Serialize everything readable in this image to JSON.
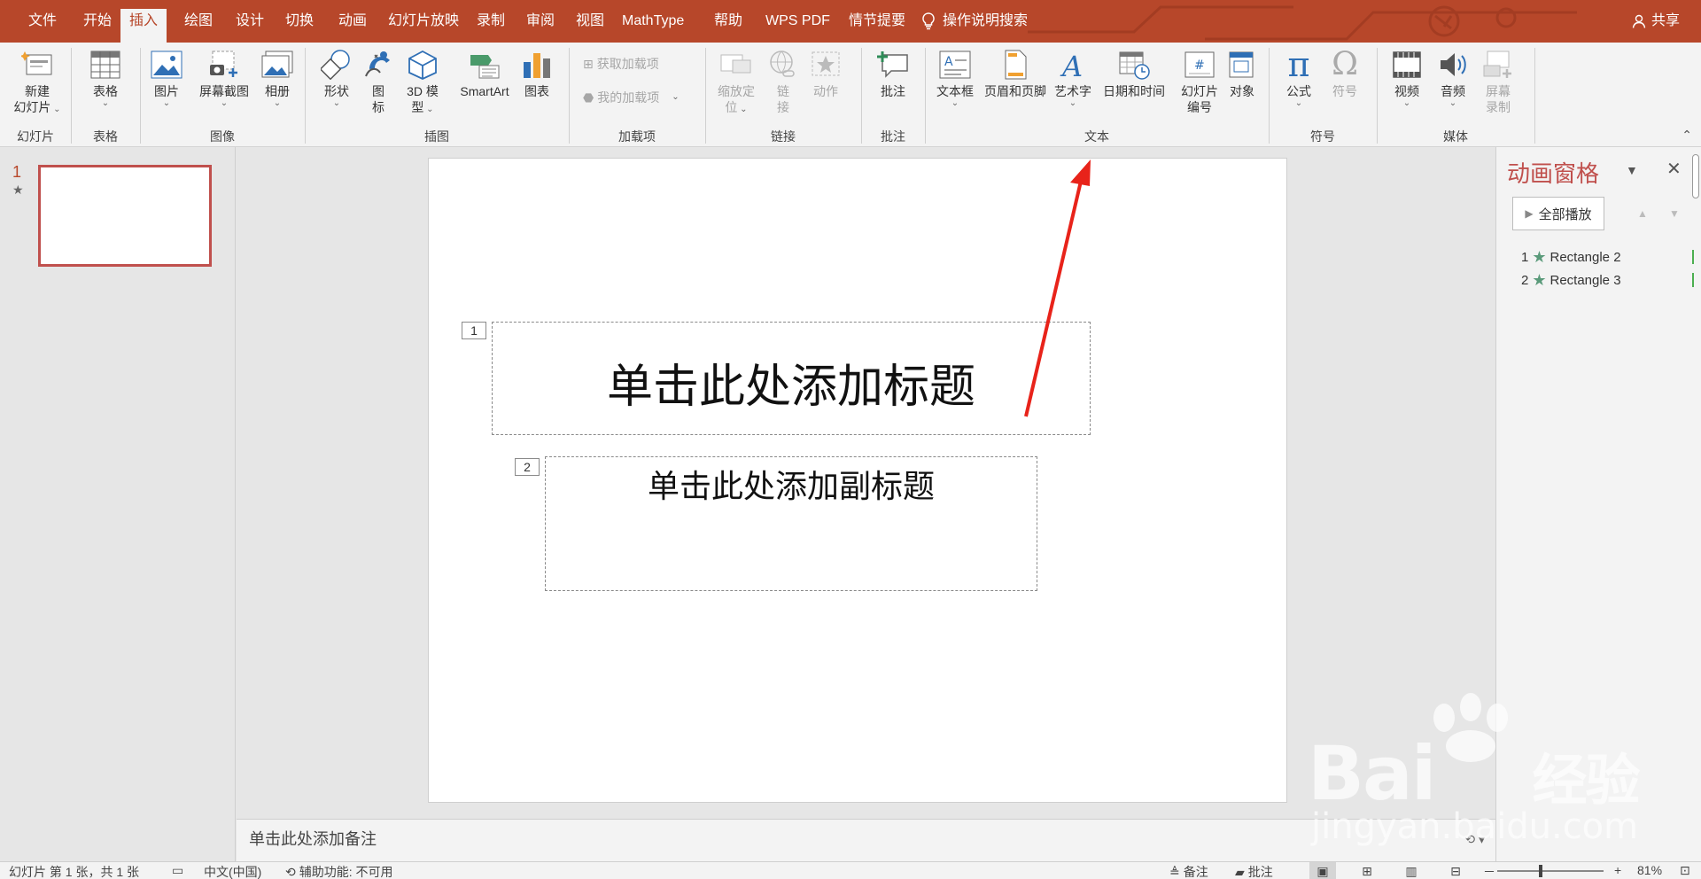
{
  "tabs": [
    {
      "label": "文件",
      "active": false
    },
    {
      "label": "开始",
      "active": false
    },
    {
      "label": "插入",
      "active": true
    },
    {
      "label": "绘图",
      "active": false
    },
    {
      "label": "设计",
      "active": false
    },
    {
      "label": "切换",
      "active": false
    },
    {
      "label": "动画",
      "active": false
    },
    {
      "label": "幻灯片放映",
      "active": false
    },
    {
      "label": "录制",
      "active": false
    },
    {
      "label": "审阅",
      "active": false
    },
    {
      "label": "视图",
      "active": false
    },
    {
      "label": "MathType",
      "active": false
    },
    {
      "label": "帮助",
      "active": false
    },
    {
      "label": "WPS PDF",
      "active": false
    },
    {
      "label": "情节提要",
      "active": false
    }
  ],
  "tell_me": "操作说明搜索",
  "share": "共享",
  "ribbon": {
    "groups": {
      "slides": "幻灯片",
      "tables": "表格",
      "images": "图像",
      "illustrations": "插图",
      "addins": "加载项",
      "links": "链接",
      "comments": "批注",
      "text": "文本",
      "symbols": "符号",
      "media": "媒体"
    },
    "buttons": {
      "new_slide": [
        "新建",
        "幻灯片"
      ],
      "table": "表格",
      "picture": "图片",
      "screenshot": "屏幕截图",
      "album": "相册",
      "shapes": "形状",
      "icons": [
        "图",
        "标"
      ],
      "model3d": [
        "3D 模",
        "型"
      ],
      "smartart": "SmartArt",
      "chart": "图表",
      "get_addins": "获取加载项",
      "my_addins": "我的加载项",
      "zoom": [
        "缩放定",
        "位"
      ],
      "link": [
        "链",
        "接"
      ],
      "action": "动作",
      "comment": "批注",
      "textbox": "文本框",
      "header_footer": "页眉和页脚",
      "wordart": "艺术字",
      "datetime": "日期和时间",
      "slide_number": [
        "幻灯片",
        "编号"
      ],
      "object": "对象",
      "equation": "公式",
      "symbol": "符号",
      "video": "视频",
      "audio": "音频",
      "screen_recording": [
        "屏幕",
        "录制"
      ]
    }
  },
  "thumbnail": {
    "number": "1",
    "star": "★"
  },
  "slide": {
    "title_placeholder": "单击此处添加标题",
    "subtitle_placeholder": "单击此处添加副标题",
    "tag1": "1",
    "tag2": "2"
  },
  "notes": {
    "placeholder": "单击此处添加备注"
  },
  "animation_pane": {
    "title": "动画窗格",
    "play_all": "全部播放",
    "items": [
      {
        "index": "1",
        "name": "Rectangle 2"
      },
      {
        "index": "2",
        "name": "Rectangle 3"
      }
    ]
  },
  "status": {
    "slide_info": "幻灯片 第 1 张，共 1 张",
    "language": "中文(中国)",
    "accessibility": "辅助功能: 不可用",
    "notes": "备注",
    "comments": "批注",
    "zoom": "81%",
    "zoom_level": 0.81,
    "minus": "－",
    "plus": "+"
  },
  "watermark": {
    "line1": "Bai",
    "brand": "经验",
    "line2": "jingyan.baidu.com"
  },
  "colors": {
    "accent": "#b7472a",
    "anim_title": "#c0504d",
    "annotation_arrow": "#e8231a"
  }
}
